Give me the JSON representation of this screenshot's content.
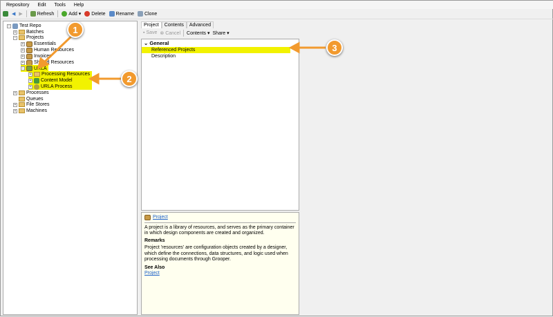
{
  "menu": [
    "Repository",
    "Edit",
    "Tools",
    "Help"
  ],
  "toolbar": {
    "refresh": "Refresh",
    "add": "Add",
    "delete": "Delete",
    "rename": "Rename",
    "clone": "Clone"
  },
  "tree": {
    "root": "Test Repo",
    "batches": "Batches",
    "projects": "Projects",
    "children": [
      "Essentials",
      "Human Resources",
      "Invoices",
      "Shared Resources"
    ],
    "urla": "URLA",
    "urla_children": [
      "Processing Resources",
      "Content Model",
      "URLA Process"
    ],
    "processes": "Processes",
    "queues": "Queues",
    "file_stores": "File Stores",
    "machines": "Machines"
  },
  "tabs": [
    "Project",
    "Contents",
    "Advanced"
  ],
  "mid_toolbar": {
    "save": "Save",
    "cancel": "Cancel",
    "contents": "Contents",
    "share": "Share"
  },
  "grid": {
    "category": "General",
    "rows": [
      "Referenced Projects",
      "Description"
    ]
  },
  "help": {
    "title": "Project",
    "desc": "A project is a library of resources, and serves as the primary container in which design components are created and organized.",
    "remarks_h": "Remarks",
    "remarks": "Project 'resources' are configuration objects created by a designer, which define the connections, data structures, and logic used when processing documents through Grooper.",
    "see_also_h": "See Also",
    "see_also_link": "Project"
  },
  "annotations": [
    "1",
    "2",
    "3"
  ],
  "colors": {
    "highlight": "#f2f200",
    "callout": "#f29a2e"
  }
}
